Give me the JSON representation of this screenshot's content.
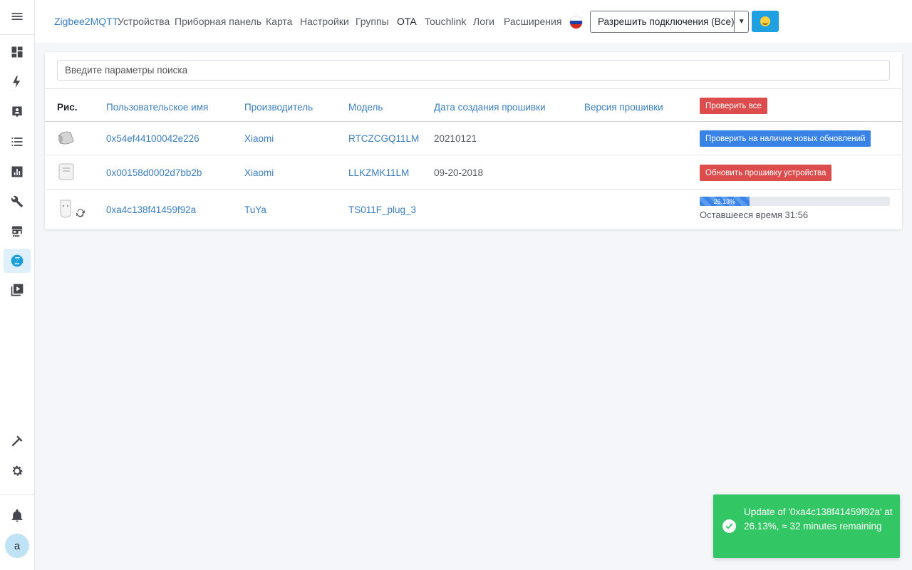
{
  "navbar": {
    "brand": "Zigbee2MQTT",
    "links": [
      "Устройства",
      "Приборная панель",
      "Карта",
      "Настройки",
      "Группы",
      "OTA",
      "Touchlink",
      "Логи",
      "Расширения"
    ],
    "active_link": "OTA",
    "permit_join_label": "Разрешить подключения (Все)"
  },
  "search": {
    "placeholder": "Введите параметры поиска"
  },
  "table": {
    "headers": {
      "pic": "Рис.",
      "friendly_name": "Пользовательское имя",
      "manufacturer": "Производитель",
      "model": "Модель",
      "fw_date": "Дата создания прошивки",
      "fw_version": "Версия прошивки"
    },
    "check_all_label": "Проверить все",
    "rows": [
      {
        "name": "0x54ef44100042e226",
        "manufacturer": "Xiaomi",
        "model": "RTCZCGQ11LM",
        "fw_date": "20210121",
        "fw_version": "",
        "action": "Проверить на наличие новых обновлений"
      },
      {
        "name": "0x00158d0002d7bb2b",
        "manufacturer": "Xiaomi",
        "model": "LLKZMK11LM",
        "fw_date": "09-20-2018",
        "fw_version": "",
        "action": "Обновить прошивку устройства"
      },
      {
        "name": "0xa4c138f41459f92a",
        "manufacturer": "TuYa",
        "model": "TS011F_plug_3",
        "fw_date": "",
        "fw_version": "",
        "progress_label": "26.13%",
        "progress": 0.2613,
        "remaining": "Оставшееся время 31:56"
      }
    ]
  },
  "toast": {
    "message": "Update of '0xa4c138f41459f92a' at 26.13%, ≈ 32 minutes remaining"
  },
  "sidebar": {
    "avatar_initial": "a"
  },
  "colors": {
    "accent": "#3a7ebf",
    "danger": "#dc4c4c",
    "primary": "#3a83e6",
    "success": "#32c664"
  }
}
